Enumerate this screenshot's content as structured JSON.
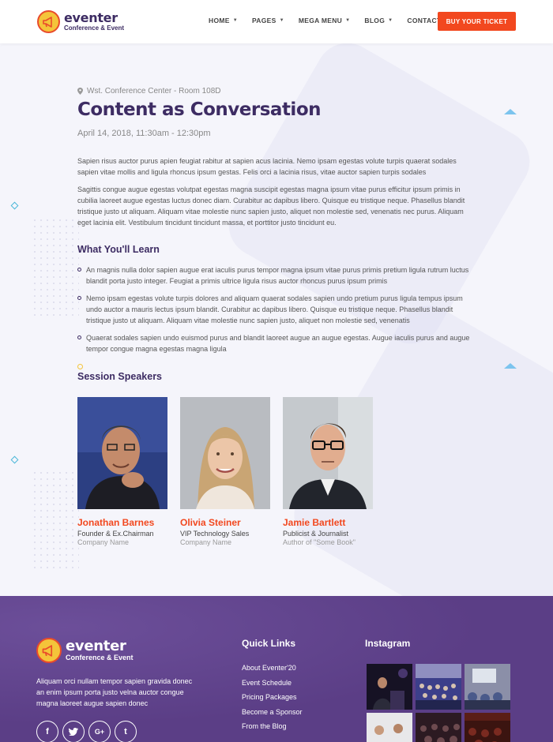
{
  "brand": {
    "name": "eventer",
    "tagline": "Conference & Event",
    "colors": {
      "primary": "#3d2c63",
      "accent": "#f2481f",
      "logo": "#f4c43a",
      "footer": "#5b3e86"
    }
  },
  "nav": {
    "items": [
      {
        "label": "HOME"
      },
      {
        "label": "PAGES"
      },
      {
        "label": "MEGA MENU"
      },
      {
        "label": "BLOG"
      },
      {
        "label": "CONTACTS"
      }
    ],
    "cta": "BUY YOUR TICKET"
  },
  "session": {
    "location": "Wst. Conference Center - Room 108D",
    "title": "Content as Conversation",
    "date": "April 14, 2018, 11:30am - 12:30pm",
    "paragraphs": [
      "Sapien risus auctor purus apien feugiat rabitur at sapien acus lacinia. Nemo ipsam egestas volute turpis quaerat sodales sapien vitae mollis and ligula rhoncus ipsum gestas. Felis orci a lacinia risus, vitae auctor sapien turpis sodales",
      "Sagittis congue augue egestas volutpat egestas magna suscipit egestas magna ipsum vitae purus efficitur ipsum primis in cubilia laoreet augue egestas luctus donec diam. Curabitur ac dapibus libero. Quisque eu tristique neque. Phasellus blandit tristique justo ut aliquam. Aliquam vitae molestie nunc sapien justo, aliquet non molestie sed, venenatis nec purus. Aliquam eget lacinia elit. Vestibulum tincidunt tincidunt massa, et porttitor justo tincidunt eu."
    ],
    "learn_heading": "What You'll Learn",
    "learn_items": [
      "An magnis nulla dolor sapien augue erat iaculis purus tempor magna ipsum vitae purus primis pretium ligula rutrum luctus blandit porta justo integer. Feugiat a primis ultrice ligula risus auctor rhoncus purus ipsum primis",
      "Nemo ipsam egestas volute turpis dolores and aliquam quaerat sodales sapien undo pretium purus ligula tempus ipsum undo auctor a mauris lectus ipsum blandit. Curabitur ac dapibus libero. Quisque eu tristique neque. Phasellus blandit tristique justo ut aliquam. Aliquam vitae molestie nunc sapien justo, aliquet non molestie sed, venenatis",
      "Quaerat sodales sapien undo euismod purus and blandit laoreet augue an augue egestas. Augue iaculis purus and augue tempor congue magna egestas magna ligula"
    ],
    "speakers_heading": "Session Speakers",
    "speakers": [
      {
        "name": "Jonathan Barnes",
        "role": "Founder & Ex.Chairman",
        "company": "Company Name"
      },
      {
        "name": "Olivia Steiner",
        "role": "VIP Technology Sales",
        "company": "Company Name"
      },
      {
        "name": "Jamie Bartlett",
        "role": "Publicist & Journalist",
        "company": "Author of \"Some Book\""
      }
    ]
  },
  "footer": {
    "about": "Aliquam orci nullam tempor sapien gravida donec an enim ipsum porta justo velna auctor congue magna laoreet augue sapien donec",
    "socials": [
      {
        "glyph": "f",
        "icon": "facebook-icon"
      },
      {
        "glyph": "t",
        "icon": "twitter-icon"
      },
      {
        "glyph": "G+",
        "icon": "google-plus-icon"
      },
      {
        "glyph": "t",
        "icon": "tumblr-icon"
      }
    ],
    "quick_links_heading": "Quick Links",
    "quick_links": [
      "About Eventer'20",
      "Event Schedule",
      "Pricing Packages",
      "Become a Sponsor",
      "From the Blog"
    ],
    "instagram_heading": "Instagram"
  }
}
